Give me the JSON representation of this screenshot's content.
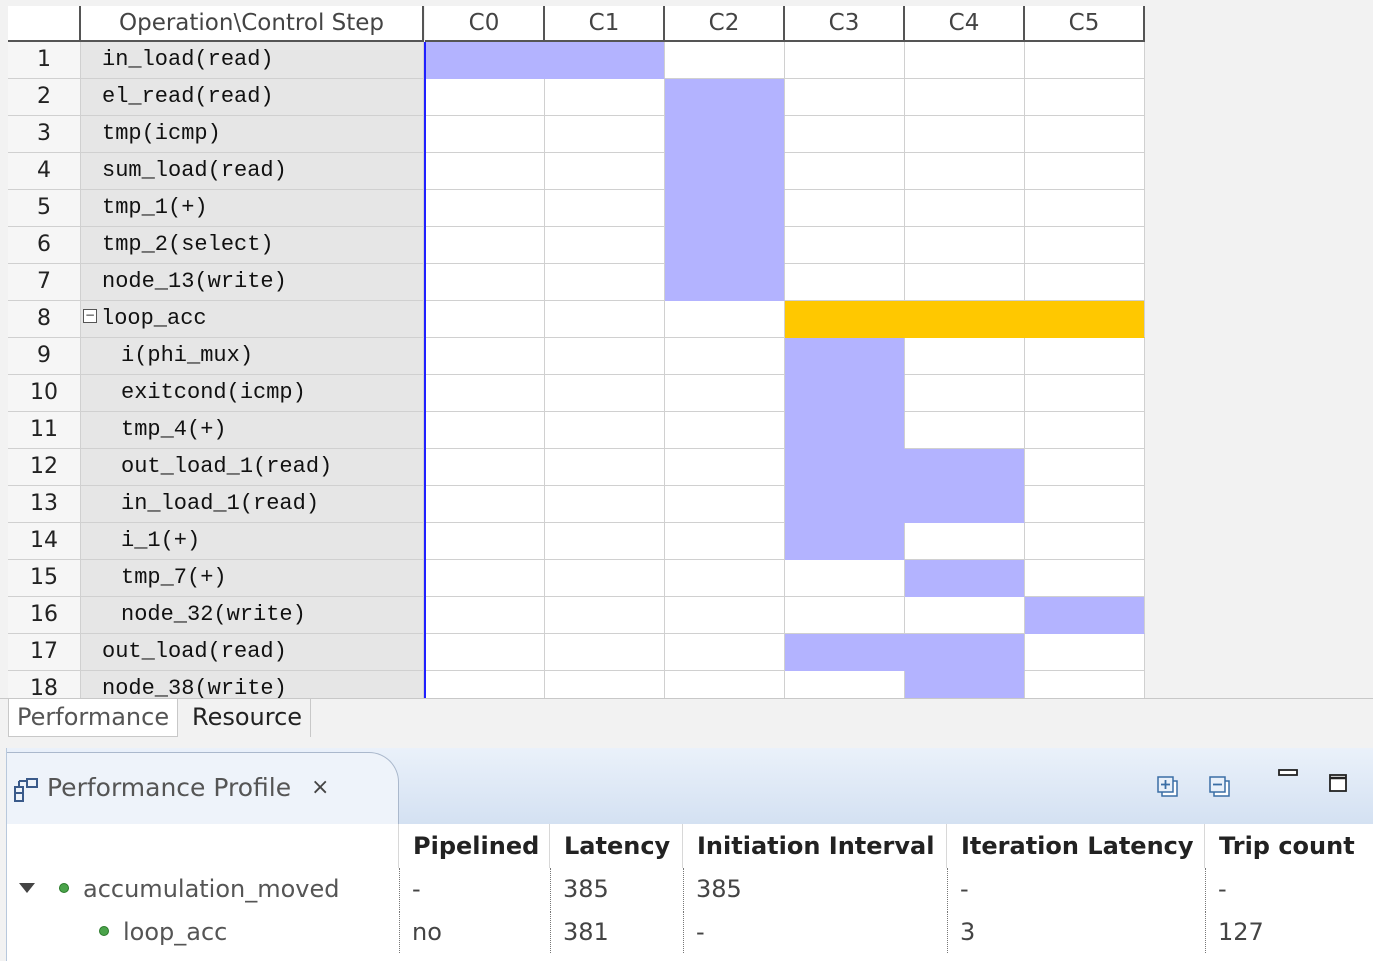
{
  "grid": {
    "header": {
      "operation": "Operation\\Control Step",
      "steps": [
        "C0",
        "C1",
        "C2",
        "C3",
        "C4",
        "C5"
      ]
    },
    "rows": [
      {
        "num": "1",
        "label": "in_load(read)",
        "indent": 0,
        "cells": [
          "blue",
          "blue",
          "",
          "",
          "",
          ""
        ]
      },
      {
        "num": "2",
        "label": "el_read(read)",
        "indent": 0,
        "cells": [
          "",
          "",
          "blue",
          "",
          "",
          ""
        ]
      },
      {
        "num": "3",
        "label": "tmp(icmp)",
        "indent": 0,
        "cells": [
          "",
          "",
          "blue",
          "",
          "",
          ""
        ]
      },
      {
        "num": "4",
        "label": "sum_load(read)",
        "indent": 0,
        "cells": [
          "",
          "",
          "blue",
          "",
          "",
          ""
        ]
      },
      {
        "num": "5",
        "label": "tmp_1(+)",
        "indent": 0,
        "cells": [
          "",
          "",
          "blue",
          "",
          "",
          ""
        ]
      },
      {
        "num": "6",
        "label": "tmp_2(select)",
        "indent": 0,
        "cells": [
          "",
          "",
          "blue",
          "",
          "",
          ""
        ]
      },
      {
        "num": "7",
        "label": "node_13(write)",
        "indent": 0,
        "cells": [
          "",
          "",
          "blue",
          "",
          "",
          ""
        ]
      },
      {
        "num": "8",
        "label": "loop_acc",
        "indent": 0,
        "toggle": "−",
        "cells": [
          "",
          "",
          "",
          "orange",
          "orange",
          "orange"
        ]
      },
      {
        "num": "9",
        "label": "i(phi_mux)",
        "indent": 1,
        "cells": [
          "",
          "",
          "",
          "blue",
          "",
          ""
        ]
      },
      {
        "num": "10",
        "label": "exitcond(icmp)",
        "indent": 1,
        "cells": [
          "",
          "",
          "",
          "blue",
          "",
          ""
        ]
      },
      {
        "num": "11",
        "label": "tmp_4(+)",
        "indent": 1,
        "cells": [
          "",
          "",
          "",
          "blue",
          "",
          ""
        ]
      },
      {
        "num": "12",
        "label": "out_load_1(read)",
        "indent": 1,
        "cells": [
          "",
          "",
          "",
          "blue",
          "blue",
          ""
        ]
      },
      {
        "num": "13",
        "label": "in_load_1(read)",
        "indent": 1,
        "cells": [
          "",
          "",
          "",
          "blue",
          "blue",
          ""
        ]
      },
      {
        "num": "14",
        "label": "i_1(+)",
        "indent": 1,
        "cells": [
          "",
          "",
          "",
          "blue",
          "",
          ""
        ]
      },
      {
        "num": "15",
        "label": "tmp_7(+)",
        "indent": 1,
        "cells": [
          "",
          "",
          "",
          "",
          "blue",
          ""
        ]
      },
      {
        "num": "16",
        "label": "node_32(write)",
        "indent": 1,
        "cells": [
          "",
          "",
          "",
          "",
          "",
          "blue"
        ]
      },
      {
        "num": "17",
        "label": "out_load(read)",
        "indent": 0,
        "cells": [
          "",
          "",
          "",
          "blue",
          "blue",
          ""
        ]
      },
      {
        "num": "18",
        "label": "node_38(write)",
        "indent": 0,
        "cells": [
          "",
          "",
          "",
          "",
          "blue",
          ""
        ]
      }
    ],
    "colors": {
      "blue": "#b3b3ff",
      "orange": "#ffc800"
    }
  },
  "editor_tabs": {
    "performance": "Performance",
    "resource": "Resource"
  },
  "profile": {
    "title": "Performance Profile",
    "close_icon": "×",
    "toolbar_icons": [
      "expand-all-icon",
      "collapse-all-icon",
      "minimize-icon",
      "maximize-icon"
    ],
    "columns": [
      "Pipelined",
      "Latency",
      "Initiation Interval",
      "Iteration Latency",
      "Trip count"
    ],
    "rows": [
      {
        "name": "accumulation_moved",
        "pipelined": "-",
        "latency": "385",
        "ii": "385",
        "iter_latency": "-",
        "trip_count": "-"
      },
      {
        "name": "loop_acc",
        "pipelined": "no",
        "latency": "381",
        "ii": "-",
        "iter_latency": "3",
        "trip_count": "127"
      }
    ]
  }
}
